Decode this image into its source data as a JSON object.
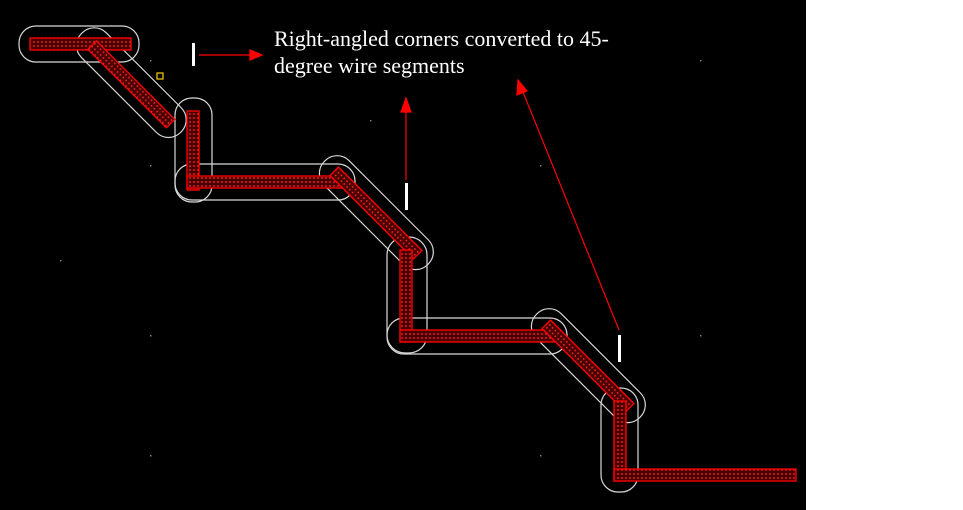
{
  "annotation": {
    "line1": "Right-angled corners converted to 45-",
    "line2": "degree wire segments"
  },
  "colors": {
    "background": "#000000",
    "wire": "#ff0000",
    "wire_hatch": "#ff2a2a",
    "outline": "#d9d9d9",
    "arrow": "#ff0000",
    "marker": "#ffffff",
    "grid_dot": "#7a7a7a",
    "cursor": "#ffcc00"
  },
  "icons": [
    "arrow-icon",
    "vertical-marker-icon",
    "cursor-square-icon"
  ]
}
